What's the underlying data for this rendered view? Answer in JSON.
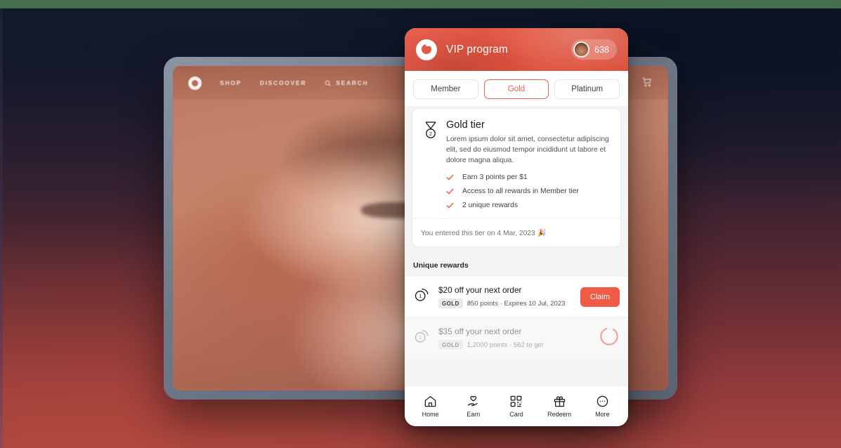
{
  "background": {
    "top_strip_color": "#46704d",
    "gradient_top_color": "#101a2a",
    "gradient_bottom_color": "#a2443f"
  },
  "tablet": {
    "nav": {
      "logo_icon": "brand-circle-logo",
      "items": [
        "SHOP",
        "DISCOOVER"
      ],
      "search_label": "SEARCH",
      "search_icon": "search-icon",
      "cart_icon": "shopping-cart-icon"
    }
  },
  "phone": {
    "header": {
      "logo_icon": "brand-circle-logo",
      "title": "VIP program",
      "avatar_icon": "user-avatar",
      "points": "638",
      "accent_color": "#e2553f"
    },
    "tier_tabs": [
      {
        "label": "Member",
        "active": false
      },
      {
        "label": "Gold",
        "active": true
      },
      {
        "label": "Platinum",
        "active": false
      }
    ],
    "tier_card": {
      "medal_icon": "medal-icon",
      "medal_number": "2",
      "title": "Gold tier",
      "description": "Lorem ipsum dolor sit amet, consectetur adipiscing elit, sed do eiusmod tempor incididunt ut labore et dolore magna aliqua.",
      "perks": [
        "Earn 3 points per $1",
        "Access to all rewards in Member tier",
        "2 unique rewards"
      ],
      "check_icon": "check-icon",
      "footer": "You entered this tier on 4 Mar, 2023 🎉"
    },
    "rewards": {
      "section_title": "Unique rewards",
      "items": [
        {
          "icon": "coins-icon",
          "name": "$20 off your next order",
          "badge": "GOLD",
          "meta": "850 points · Expires 10 Jul, 2023",
          "action_label": "Claim",
          "locked": false
        },
        {
          "icon": "coins-icon",
          "name": "$35 off your next order",
          "badge": "GOLD",
          "meta": "1,2000 points · 562 to go!",
          "progress_icon": "progress-ring",
          "locked": true
        }
      ]
    },
    "bottom_nav": [
      {
        "icon": "home-icon",
        "label": "Home"
      },
      {
        "icon": "hand-heart-icon",
        "label": "Earn"
      },
      {
        "icon": "qr-code-icon",
        "label": "Card"
      },
      {
        "icon": "gift-icon",
        "label": "Redeem"
      },
      {
        "icon": "more-circle-icon",
        "label": "More"
      }
    ]
  }
}
